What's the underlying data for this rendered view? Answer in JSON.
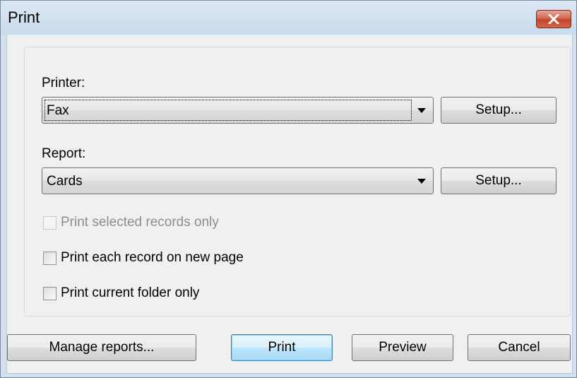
{
  "window": {
    "title": "Print",
    "close_icon": "close-x-icon"
  },
  "printer": {
    "label": "Printer:",
    "selected": "Fax",
    "setup_label": "Setup..."
  },
  "report": {
    "label": "Report:",
    "selected": "Cards",
    "setup_label": "Setup..."
  },
  "options": {
    "selected_only": {
      "label": "Print selected records only",
      "checked": false,
      "enabled": false
    },
    "new_page": {
      "label": "Print each record on new page",
      "checked": false,
      "enabled": true
    },
    "current_folder": {
      "label": "Print current folder only",
      "checked": false,
      "enabled": true
    }
  },
  "footer": {
    "manage_label": "Manage reports...",
    "print_label": "Print",
    "preview_label": "Preview",
    "cancel_label": "Cancel"
  },
  "colors": {
    "close_button": "#c2432a",
    "default_button_border": "#3c7fb1",
    "disabled_text": "#8d8d8d"
  }
}
